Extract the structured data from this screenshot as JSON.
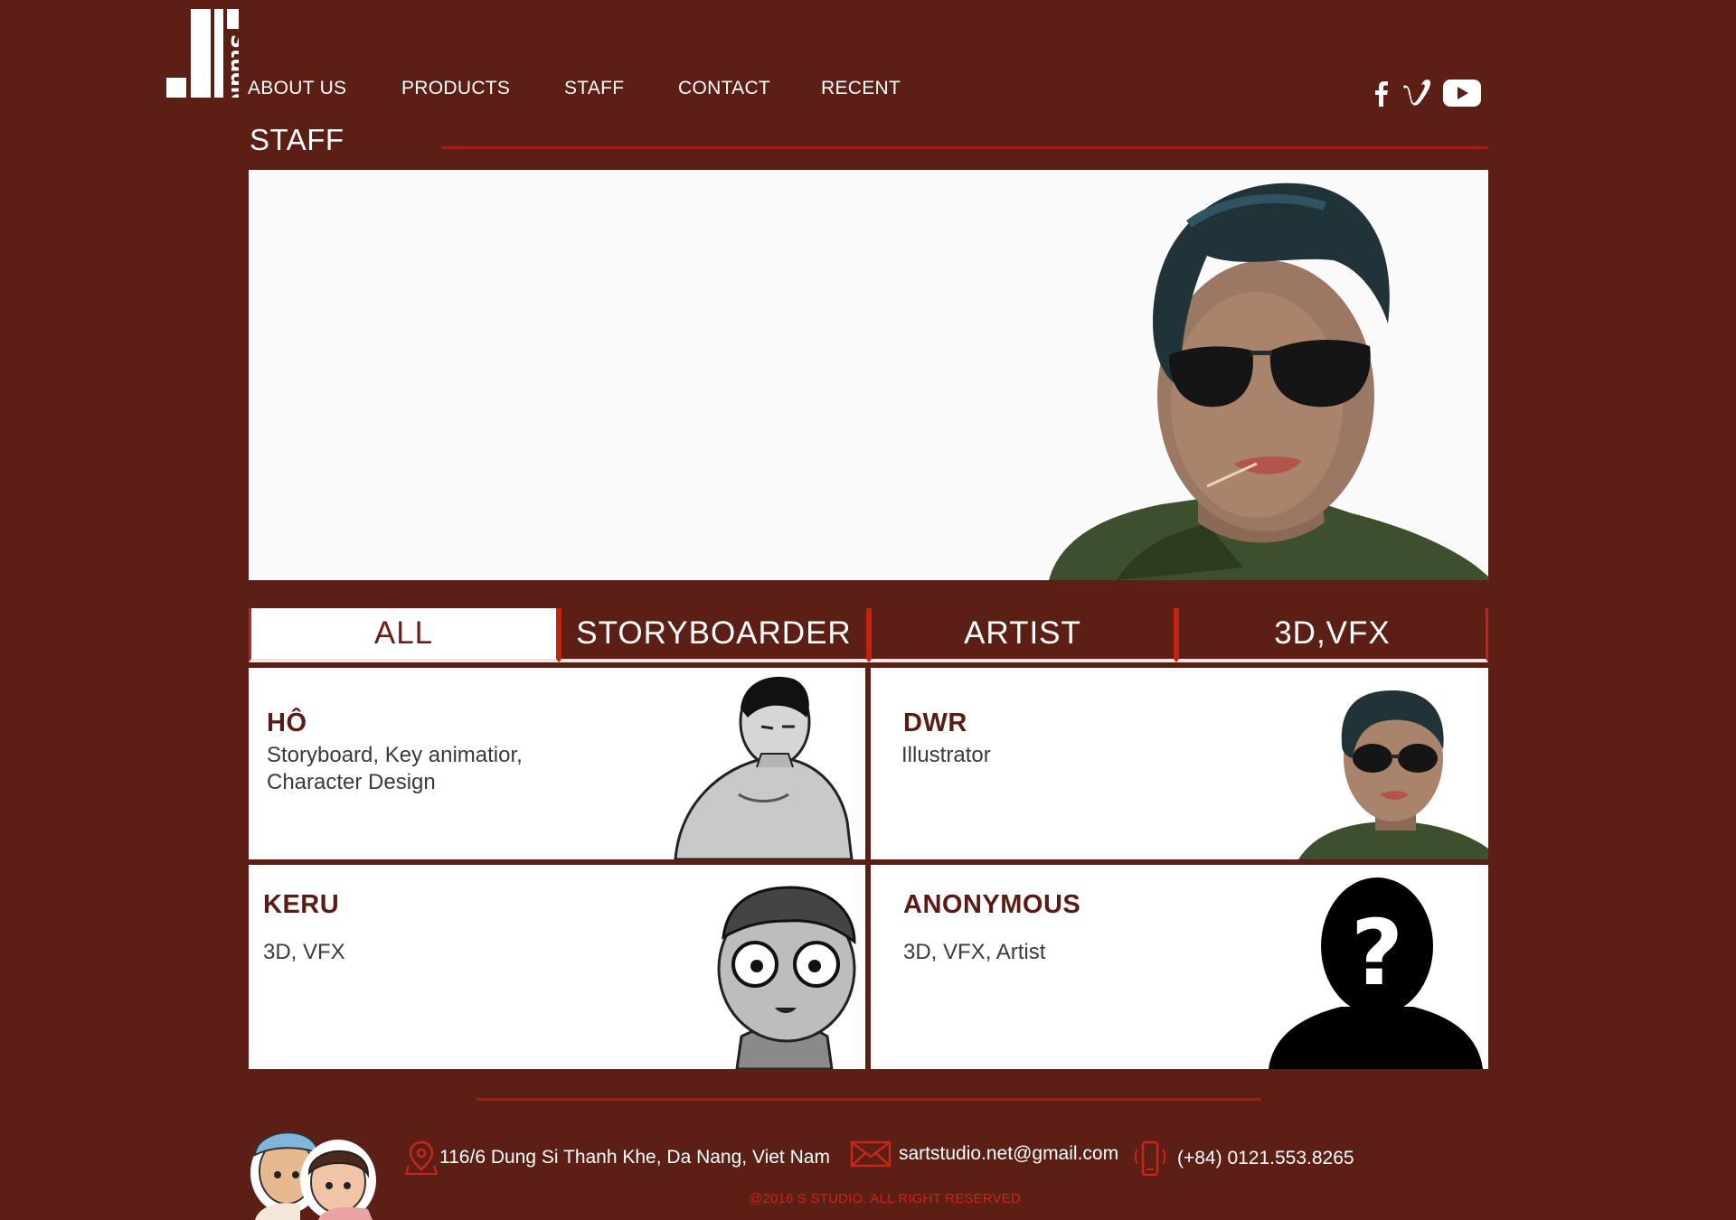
{
  "brand": {
    "logo_text": "Studio"
  },
  "nav": {
    "items": [
      "ABOUT US",
      "PRODUCTS",
      "STAFF",
      "CONTACT",
      "RECENT"
    ]
  },
  "social": {
    "icons": [
      "facebook-icon",
      "vimeo-icon",
      "youtube-icon"
    ]
  },
  "section": {
    "title": "STAFF"
  },
  "tabs": [
    "ALL",
    "STORYBOARDER",
    "ARTIST",
    "3D,VFX"
  ],
  "staff": [
    {
      "name": "HÔ",
      "role": "Storyboard, Key animatior, Character Design"
    },
    {
      "name": "DWR",
      "role": "Illustrator"
    },
    {
      "name": "KERU",
      "role": "3D, VFX"
    },
    {
      "name": "ANONYMOUS",
      "role": "3D, VFX, Artist"
    }
  ],
  "footer": {
    "address": "116/6 Dung Si Thanh Khe, Da Nang, Viet Nam",
    "email": "sartstudio.net@gmail.com",
    "phone": "(+84) 0121.553.8265",
    "copyright": "@2016 S STUDIO. ALL RIGHT RESERVED"
  },
  "colors": {
    "background": "#5b1f16",
    "accent": "#a11e10",
    "tab_border": "#c22313",
    "text_dark": "#5a1b12"
  }
}
